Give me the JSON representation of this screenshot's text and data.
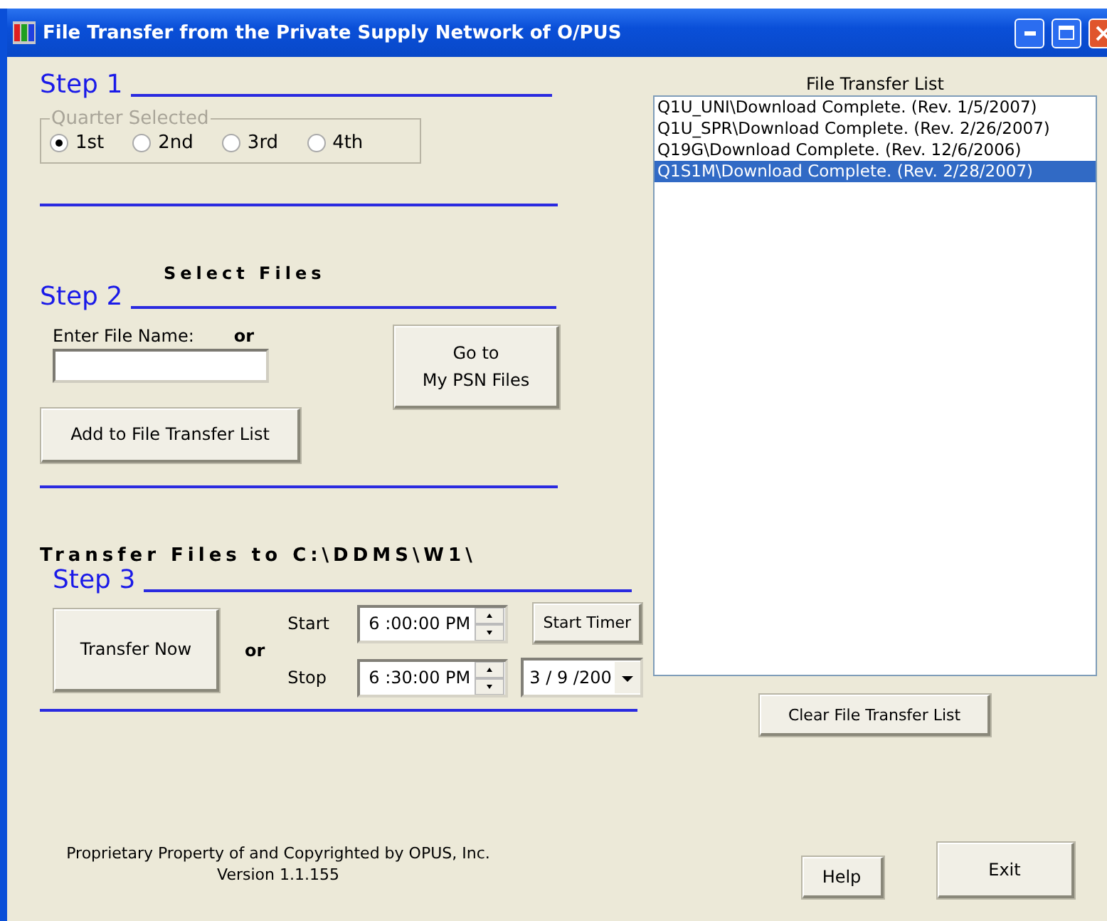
{
  "window": {
    "title": "File Transfer from the Private Supply Network of O/PUS"
  },
  "step1": {
    "heading": "Step 1",
    "quarter_group": {
      "legend": "Quarter Selected",
      "options": [
        {
          "label": "1st",
          "selected": true
        },
        {
          "label": "2nd",
          "selected": false
        },
        {
          "label": "3rd",
          "selected": false
        },
        {
          "label": "4th",
          "selected": false
        }
      ]
    }
  },
  "step2": {
    "caption": "Select Files",
    "heading": "Step 2",
    "file_name_label": "Enter File Name:",
    "or": "or",
    "go_button": "Go to\nMy PSN Files",
    "add_button": "Add to File Transfer List"
  },
  "step3": {
    "caption": "Transfer Files to C:\\DDMS\\W1\\",
    "heading": "Step 3",
    "transfer_button": "Transfer Now",
    "or": "or",
    "start_label": "Start",
    "start_time": "6 :00:00 PM",
    "start_timer_button": "Start Timer",
    "stop_label": "Stop",
    "stop_time": "6 :30:00 PM",
    "date": "3 / 9 /200"
  },
  "transfer_list": {
    "title": "File Transfer List",
    "items": [
      {
        "text": "Q1U_UNI\\Download Complete. (Rev. 1/5/2007)",
        "selected": false
      },
      {
        "text": "Q1U_SPR\\Download Complete. (Rev. 2/26/2007)",
        "selected": false
      },
      {
        "text": "Q19G\\Download Complete. (Rev. 12/6/2006)",
        "selected": false
      },
      {
        "text": "Q1S1M\\Download Complete. (Rev. 2/28/2007)",
        "selected": true
      }
    ],
    "clear_button": "Clear File Transfer List"
  },
  "footer": {
    "copyright": "Proprietary Property of and Copyrighted by OPUS, Inc.",
    "version": "Version 1.1.155"
  },
  "help_button": "Help",
  "exit_button": "Exit"
}
